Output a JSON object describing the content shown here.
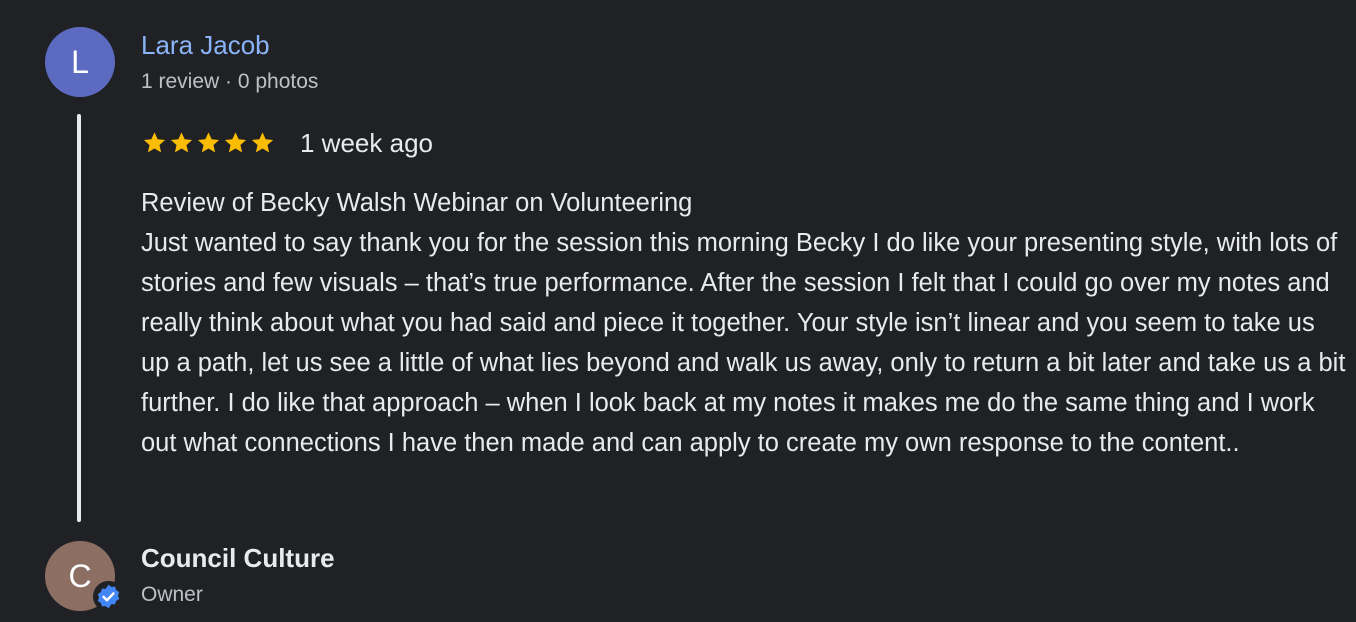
{
  "review": {
    "author": {
      "initial": "L",
      "name": "Lara Jacob",
      "meta": "1 review · 0 photos"
    },
    "rating": 5,
    "star_color": "#fbbc04",
    "date": "1 week ago",
    "text": "Review of Becky Walsh Webinar on Volunteering\nJust wanted to say thank you for the session this morning Becky I do like your presenting style, with lots of stories and few visuals – that’s true performance. After the session I felt that I could go over my notes and really think about what you had said and piece it together. Your style isn’t linear and you seem to take us up a path, let us see a little of what lies beyond and walk us away, only to return a bit later and take us a bit further. I do like that approach – when I look back at my notes it makes me do the same thing and I work out what connections I have then made and can apply to create my own response to the content.."
  },
  "owner_response": {
    "initial": "C",
    "name": "Council Culture",
    "role": "Owner",
    "badge_icon": "verified-check-icon",
    "badge_color": "#4285f4"
  },
  "colors": {
    "background": "#202124",
    "link": "#8ab4f8",
    "reviewer_avatar": "#5c6bc0",
    "owner_avatar": "#8d6e63"
  }
}
